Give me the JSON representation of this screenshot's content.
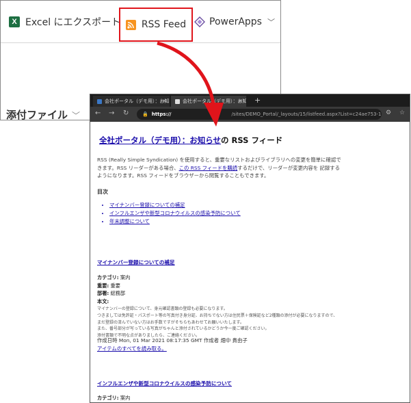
{
  "toolbar": {
    "excel_label": "Excel にエクスポート",
    "rss_label": "RSS Feed",
    "powerapps_label": "PowerApps"
  },
  "attachments_label": "添付ファイル",
  "browser": {
    "tabs": [
      {
        "title": "会社ポータル（デモ用）：お知らせ"
      },
      {
        "title": "会社ポータル（デモ用）：お知らせ"
      }
    ],
    "url_scheme": "https://",
    "url_rest": "/sites/DEMO_Portal/_layouts/15/listfeed.aspx?List=c24ae753-1..."
  },
  "page": {
    "heading_link": "全社ポータル（デモ用）：お知らせ",
    "heading_suffix": "の RSS フィード",
    "intro_1": "RSS (Really Simple Syndication) を使用すると、重要なリストおよびライブラリへの変更を簡単に確認できます。RSS リーダーがある場合、",
    "intro_link": "この RSS フィードを購読",
    "intro_2": "するだけで、リーダーが変更内容を 記録するようになります。RSS フィードをブラウザーから閲覧することもできます。",
    "toc_title": "目次",
    "toc_items": [
      "マイナンバー登録についての補足",
      "インフルエンザや新型コロナウイルスの感染予防について",
      "年末調整について"
    ],
    "sections": [
      {
        "title": "マイナンバー登録についての補足",
        "category_label": "カテゴリ:",
        "category": "案内",
        "importance_label": "重要:",
        "importance": "重要",
        "department_label": "部署:",
        "department": "総務部",
        "body_label": "本文:",
        "body_lines": [
          "マイナンバーの登録について、身元確認書類の登録も必要になります。",
          "つきましては免許証・パスポート等の写真付き身分証、お持ちでない方は住民票＋保険証など2種類の添付が必要になりますので、",
          "まだ登録の済んでいない方はお手数ですがそちらもあわせてお願いいたします。",
          "また、番号部分が写っている写真がちゃんと添付されているかどうか今一度ご確認ください。",
          "添付書類で不明な点がありましたら、ご連絡ください。"
        ],
        "created": "作成日時 Mon, 01 Mar 2021 08:17:35 GMT 作成者 畑中 貴由子",
        "read_more": "アイテムのすべてを読み取る。"
      },
      {
        "title": "インフルエンザや新型コロナウイルスの感染予防について",
        "category_label": "カテゴリ:",
        "category": "案内"
      }
    ]
  },
  "colors": {
    "highlight_red": "#e0141b",
    "rss_orange": "#f79420",
    "excel_green": "#1d6f42",
    "link_blue": "#1a0dab"
  }
}
